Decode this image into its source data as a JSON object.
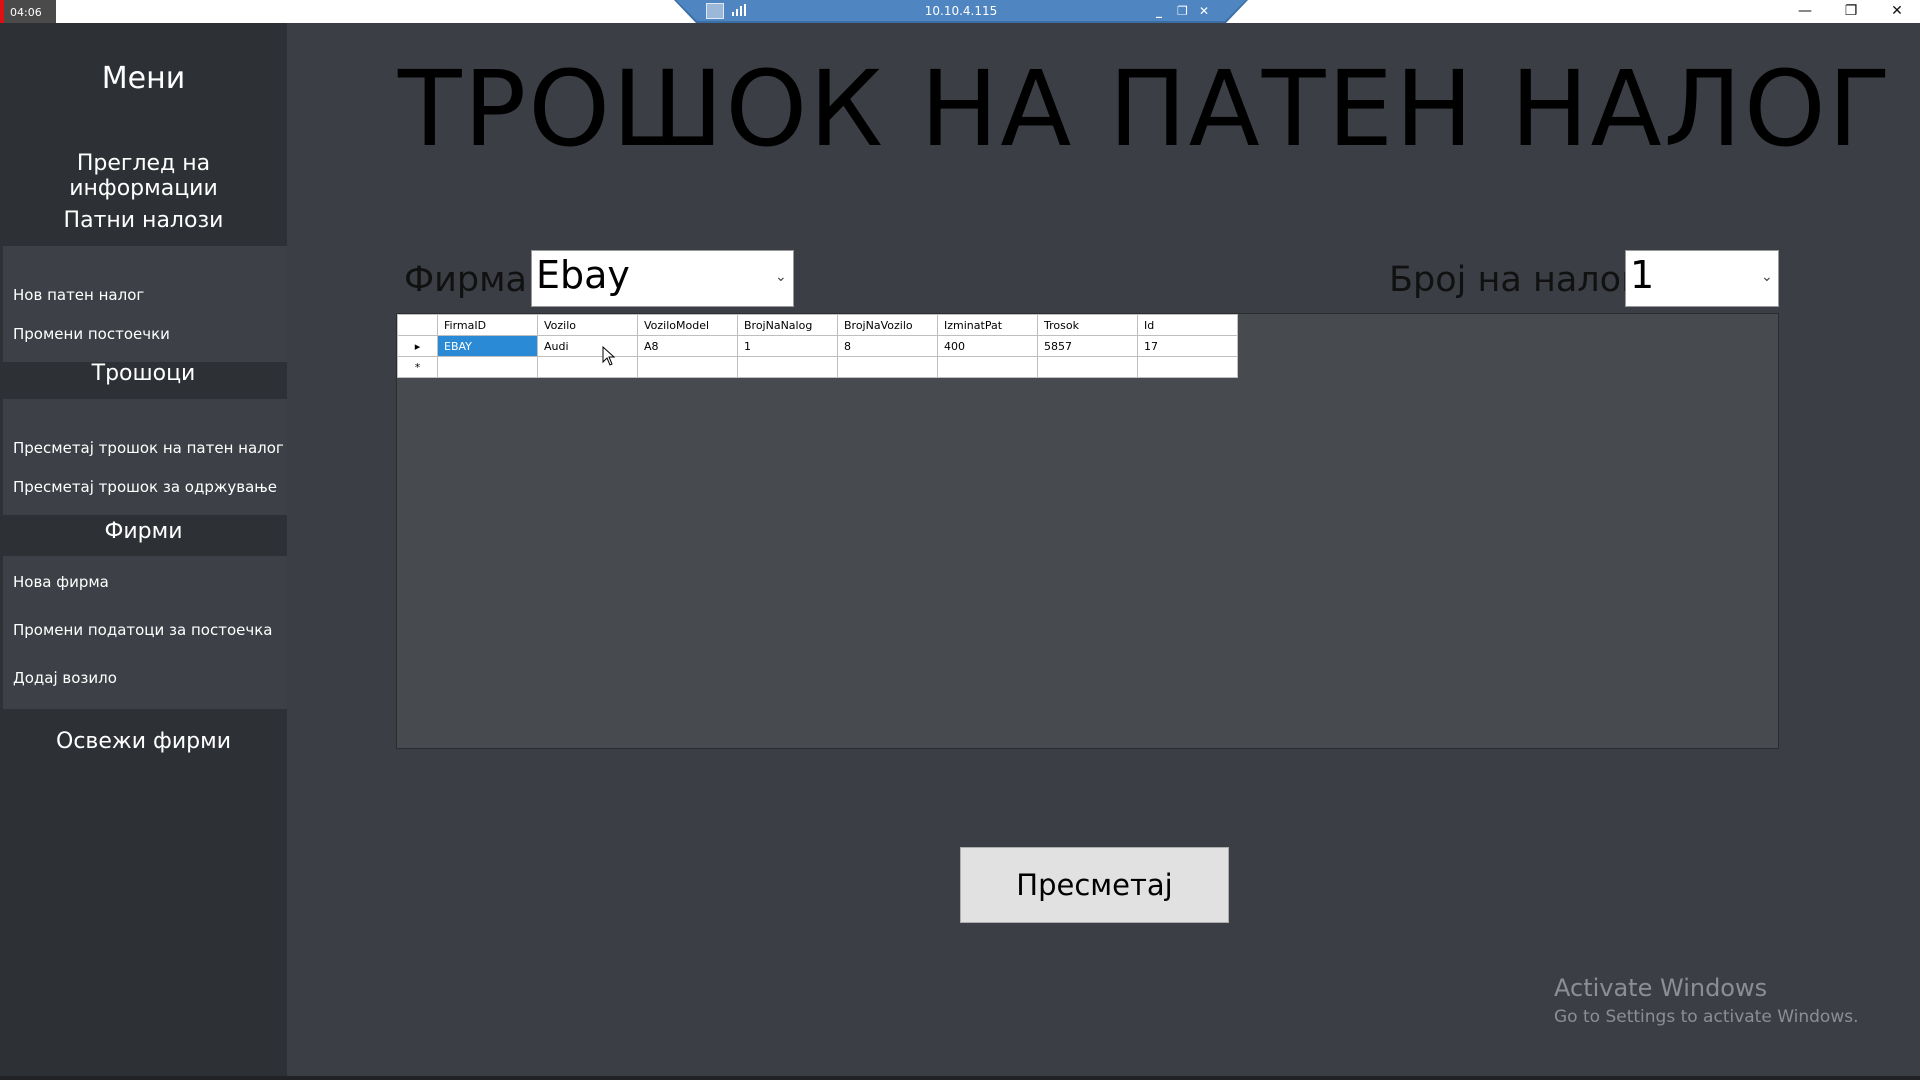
{
  "system": {
    "clock": "04:06",
    "window_controls": [
      "—",
      "❐",
      "✕"
    ]
  },
  "rdp": {
    "host": "10.10.4.115",
    "controls": [
      "_",
      "❐",
      "✕"
    ]
  },
  "sidebar": {
    "title": "Мени",
    "overview": "Преглед на информации",
    "travel_orders": {
      "heading": "Патни налози",
      "items": [
        "Нов патен налог",
        "Промени постоечки"
      ]
    },
    "costs": {
      "heading": "Трошоци",
      "items": [
        "Пресметај трошок на патен налог",
        "Пресметај трошок за одржување"
      ]
    },
    "companies": {
      "heading": "Фирми",
      "items": [
        "Нова фирма",
        "Промени податоци за постоечка",
        "Додај возило"
      ]
    },
    "refresh": "Освежи фирми"
  },
  "main": {
    "title": "ТРОШОК НА ПАТЕН НАЛОГ",
    "company_label": "Фирма",
    "company_value": "Ebay",
    "order_label": "Број на налог",
    "order_value": "1",
    "calculate_button": "Пресметај"
  },
  "grid": {
    "columns": [
      "FirmaID",
      "Vozilo",
      "VoziloModel",
      "BrojNaNalog",
      "BrojNaVozilo",
      "IzminatPat",
      "Trosok",
      "Id"
    ],
    "rows": [
      [
        "EBAY",
        "Audi",
        "A8",
        "1",
        "8",
        "400",
        "5857",
        "17"
      ]
    ],
    "new_row_marker": "*",
    "current_row_marker": "▸"
  },
  "watermark": {
    "title": "Activate Windows",
    "subtitle": "Go to Settings to activate Windows."
  },
  "colors": {
    "background": "#3b3f45",
    "sidebar": "#2d3035",
    "selection": "#2a8ad6"
  }
}
